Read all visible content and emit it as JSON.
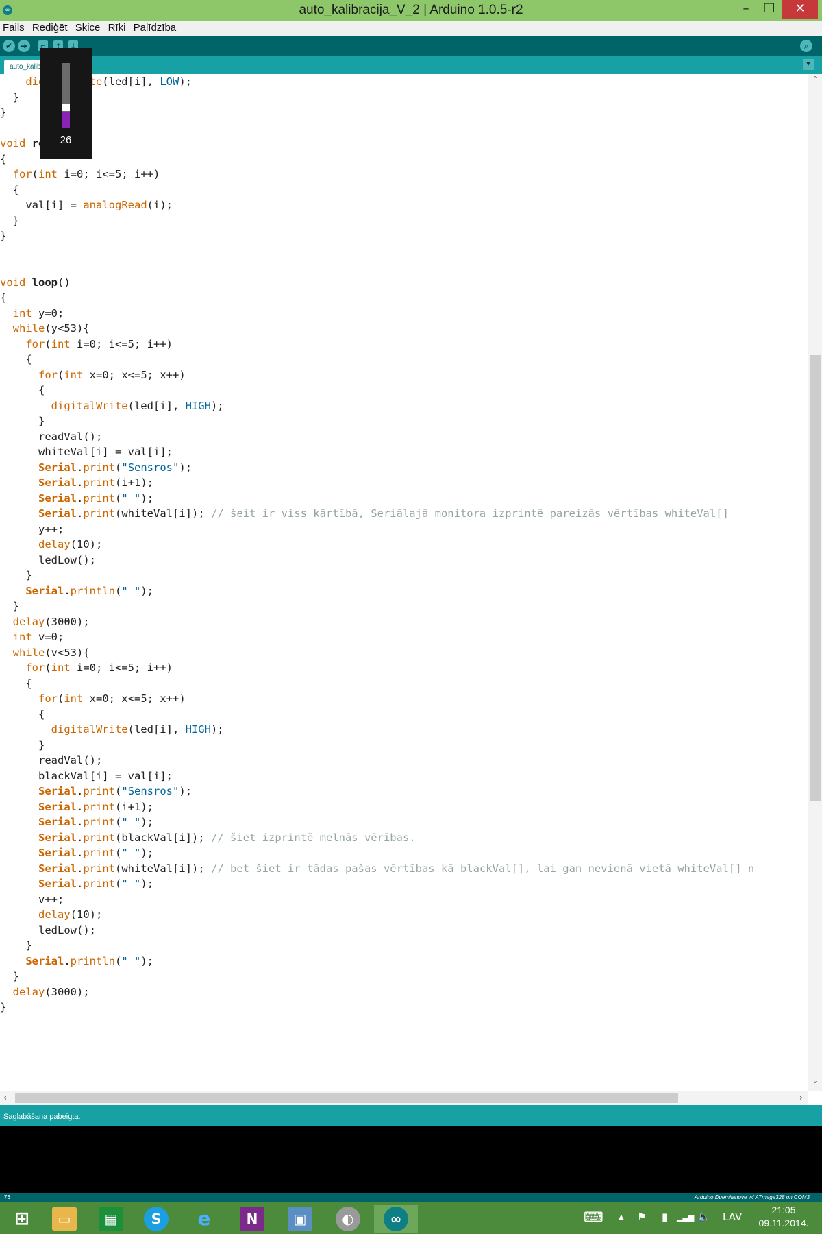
{
  "window": {
    "title": "auto_kalibracija_V_2 | Arduino 1.0.5-r2",
    "controls": {
      "minimize": "–",
      "restore": "❐",
      "close": "✕"
    }
  },
  "menu": [
    "Fails",
    "Rediģēt",
    "Skice",
    "Rīki",
    "Palīdzība"
  ],
  "toolbar": {
    "buttons": [
      "verify-icon",
      "upload-icon",
      "new-icon",
      "open-icon",
      "save-icon"
    ],
    "serial_monitor": "serial-monitor-icon"
  },
  "tabs": [
    {
      "label": "auto_kalibracija_V_2"
    }
  ],
  "volume_osd": {
    "level": "26",
    "fill_fraction": 0.26
  },
  "code": [
    [
      [
        "",
        "    "
      ],
      [
        "fn",
        "digitalWrite"
      ],
      [
        "",
        "(led[i], "
      ],
      [
        "ct",
        "LOW"
      ],
      [
        "",
        ");"
      ]
    ],
    [
      [
        "",
        "  }"
      ]
    ],
    [
      [
        "",
        "}"
      ]
    ],
    [
      [
        "",
        ""
      ]
    ],
    [
      [
        "kw",
        "void"
      ],
      [
        "",
        " "
      ],
      [
        "bd",
        "readVal"
      ],
      [
        "",
        "()"
      ]
    ],
    [
      [
        "",
        "{"
      ]
    ],
    [
      [
        "",
        "  "
      ],
      [
        "kw",
        "for"
      ],
      [
        "",
        "("
      ],
      [
        "kw",
        "int"
      ],
      [
        "",
        " i=0; i<=5; i++)"
      ]
    ],
    [
      [
        "",
        "  {"
      ]
    ],
    [
      [
        "",
        "    val[i] = "
      ],
      [
        "fn",
        "analogRead"
      ],
      [
        "",
        "(i);"
      ]
    ],
    [
      [
        "",
        "  }"
      ]
    ],
    [
      [
        "",
        "}"
      ]
    ],
    [
      [
        "",
        ""
      ]
    ],
    [
      [
        "",
        ""
      ]
    ],
    [
      [
        "kw",
        "void"
      ],
      [
        "",
        " "
      ],
      [
        "bd",
        "loop"
      ],
      [
        "",
        "()"
      ]
    ],
    [
      [
        "",
        "{"
      ]
    ],
    [
      [
        "",
        "  "
      ],
      [
        "kw",
        "int"
      ],
      [
        "",
        " y=0;"
      ]
    ],
    [
      [
        "",
        "  "
      ],
      [
        "kw",
        "while"
      ],
      [
        "",
        "(y<53){"
      ]
    ],
    [
      [
        "",
        "    "
      ],
      [
        "kw",
        "for"
      ],
      [
        "",
        "("
      ],
      [
        "kw",
        "int"
      ],
      [
        "",
        " i=0; i<=5; i++)"
      ]
    ],
    [
      [
        "",
        "    {"
      ]
    ],
    [
      [
        "",
        "      "
      ],
      [
        "kw",
        "for"
      ],
      [
        "",
        "("
      ],
      [
        "kw",
        "int"
      ],
      [
        "",
        " x=0; x<=5; x++)"
      ]
    ],
    [
      [
        "",
        "      {"
      ]
    ],
    [
      [
        "",
        "        "
      ],
      [
        "fn",
        "digitalWrite"
      ],
      [
        "",
        "(led[i], "
      ],
      [
        "ct",
        "HIGH"
      ],
      [
        "",
        ");"
      ]
    ],
    [
      [
        "",
        "      }"
      ]
    ],
    [
      [
        "",
        "      readVal();"
      ]
    ],
    [
      [
        "",
        "      whiteVal[i] = val[i];"
      ]
    ],
    [
      [
        "",
        "      "
      ],
      [
        "sr",
        "Serial"
      ],
      [
        "",
        "."
      ],
      [
        "fn",
        "print"
      ],
      [
        "",
        "("
      ],
      [
        "st",
        "\"Sensros\""
      ],
      [
        "",
        ");"
      ]
    ],
    [
      [
        "",
        "      "
      ],
      [
        "sr",
        "Serial"
      ],
      [
        "",
        "."
      ],
      [
        "fn",
        "print"
      ],
      [
        "",
        "(i+1);"
      ]
    ],
    [
      [
        "",
        "      "
      ],
      [
        "sr",
        "Serial"
      ],
      [
        "",
        "."
      ],
      [
        "fn",
        "print"
      ],
      [
        "",
        "("
      ],
      [
        "st",
        "\" \""
      ],
      [
        "",
        ");"
      ]
    ],
    [
      [
        "",
        "      "
      ],
      [
        "sr",
        "Serial"
      ],
      [
        "",
        "."
      ],
      [
        "fn",
        "print"
      ],
      [
        "",
        "(whiteVal[i]); "
      ],
      [
        "cm",
        "// šeit ir viss kārtībā, Seriālajā monitora izprintē pareizās vērtības whiteVal[]"
      ]
    ],
    [
      [
        "",
        "      y++;"
      ]
    ],
    [
      [
        "",
        "      "
      ],
      [
        "fn",
        "delay"
      ],
      [
        "",
        "(10);"
      ]
    ],
    [
      [
        "",
        "      ledLow();"
      ]
    ],
    [
      [
        "",
        "    }"
      ]
    ],
    [
      [
        "",
        "    "
      ],
      [
        "sr",
        "Serial"
      ],
      [
        "",
        "."
      ],
      [
        "fn",
        "println"
      ],
      [
        "",
        "("
      ],
      [
        "st",
        "\" \""
      ],
      [
        "",
        ");"
      ]
    ],
    [
      [
        "",
        "  }"
      ]
    ],
    [
      [
        "",
        "  "
      ],
      [
        "fn",
        "delay"
      ],
      [
        "",
        "(3000);"
      ]
    ],
    [
      [
        "",
        "  "
      ],
      [
        "kw",
        "int"
      ],
      [
        "",
        " v=0;"
      ]
    ],
    [
      [
        "",
        "  "
      ],
      [
        "kw",
        "while"
      ],
      [
        "",
        "(v<53){"
      ]
    ],
    [
      [
        "",
        "    "
      ],
      [
        "kw",
        "for"
      ],
      [
        "",
        "("
      ],
      [
        "kw",
        "int"
      ],
      [
        "",
        " i=0; i<=5; i++)"
      ]
    ],
    [
      [
        "",
        "    {"
      ]
    ],
    [
      [
        "",
        "      "
      ],
      [
        "kw",
        "for"
      ],
      [
        "",
        "("
      ],
      [
        "kw",
        "int"
      ],
      [
        "",
        " x=0; x<=5; x++)"
      ]
    ],
    [
      [
        "",
        "      {"
      ]
    ],
    [
      [
        "",
        "        "
      ],
      [
        "fn",
        "digitalWrite"
      ],
      [
        "",
        "(led[i], "
      ],
      [
        "ct",
        "HIGH"
      ],
      [
        "",
        ");"
      ]
    ],
    [
      [
        "",
        "      }"
      ]
    ],
    [
      [
        "",
        "      readVal();"
      ]
    ],
    [
      [
        "",
        "      blackVal[i] = val[i];"
      ]
    ],
    [
      [
        "",
        "      "
      ],
      [
        "sr",
        "Serial"
      ],
      [
        "",
        "."
      ],
      [
        "fn",
        "print"
      ],
      [
        "",
        "("
      ],
      [
        "st",
        "\"Sensros\""
      ],
      [
        "",
        ");"
      ]
    ],
    [
      [
        "",
        "      "
      ],
      [
        "sr",
        "Serial"
      ],
      [
        "",
        "."
      ],
      [
        "fn",
        "print"
      ],
      [
        "",
        "(i+1);"
      ]
    ],
    [
      [
        "",
        "      "
      ],
      [
        "sr",
        "Serial"
      ],
      [
        "",
        "."
      ],
      [
        "fn",
        "print"
      ],
      [
        "",
        "("
      ],
      [
        "st",
        "\" \""
      ],
      [
        "",
        ");"
      ]
    ],
    [
      [
        "",
        "      "
      ],
      [
        "sr",
        "Serial"
      ],
      [
        "",
        "."
      ],
      [
        "fn",
        "print"
      ],
      [
        "",
        "(blackVal[i]); "
      ],
      [
        "cm",
        "// šiet izprintē melnās vērības."
      ]
    ],
    [
      [
        "",
        "      "
      ],
      [
        "sr",
        "Serial"
      ],
      [
        "",
        "."
      ],
      [
        "fn",
        "print"
      ],
      [
        "",
        "("
      ],
      [
        "st",
        "\" \""
      ],
      [
        "",
        ");"
      ]
    ],
    [
      [
        "",
        "      "
      ],
      [
        "sr",
        "Serial"
      ],
      [
        "",
        "."
      ],
      [
        "fn",
        "print"
      ],
      [
        "",
        "(whiteVal[i]); "
      ],
      [
        "cm",
        "// bet šiet ir tādas pašas vērtības kā blackVal[], lai gan nevienā vietā whiteVal[] n"
      ]
    ],
    [
      [
        "",
        "      "
      ],
      [
        "sr",
        "Serial"
      ],
      [
        "",
        "."
      ],
      [
        "fn",
        "print"
      ],
      [
        "",
        "("
      ],
      [
        "st",
        "\" \""
      ],
      [
        "",
        ");"
      ]
    ],
    [
      [
        "",
        "      v++;"
      ]
    ],
    [
      [
        "",
        "      "
      ],
      [
        "fn",
        "delay"
      ],
      [
        "",
        "(10);"
      ]
    ],
    [
      [
        "",
        "      ledLow();"
      ]
    ],
    [
      [
        "",
        "    }"
      ]
    ],
    [
      [
        "",
        "    "
      ],
      [
        "sr",
        "Serial"
      ],
      [
        "",
        "."
      ],
      [
        "fn",
        "println"
      ],
      [
        "",
        "("
      ],
      [
        "st",
        "\" \""
      ],
      [
        "",
        ");"
      ]
    ],
    [
      [
        "",
        "  }"
      ]
    ],
    [
      [
        "",
        "  "
      ],
      [
        "fn",
        "delay"
      ],
      [
        "",
        "(3000);"
      ]
    ],
    [
      [
        "",
        "}"
      ]
    ]
  ],
  "status": {
    "message": "Saglabāšana pabeigta."
  },
  "footer": {
    "line_number": "76",
    "board": "Arduino Duemilanove w/ ATmega328 on COM3"
  },
  "taskbar": {
    "apps": [
      "start-icon",
      "file-explorer-icon",
      "store-icon",
      "skype-icon",
      "internet-explorer-icon",
      "onenote-icon",
      "remote-desktop-icon",
      "media-player-icon",
      "arduino-icon"
    ],
    "tray": {
      "keyboard": "⌨",
      "chevron": "▲",
      "flag": "⚑",
      "battery": "▮",
      "signal": "▂▄▆",
      "volume": "🔈",
      "language": "LAV"
    },
    "clock": {
      "time": "21:05",
      "date": "09.11.2014."
    }
  },
  "colors": {
    "titlebar": "#8ec66a",
    "toolbar": "#006468",
    "tabbar": "#17a1a5",
    "keyword": "#cc6600",
    "constant": "#006699",
    "comment": "#95a5a6",
    "taskbar": "#4b8b3b"
  }
}
